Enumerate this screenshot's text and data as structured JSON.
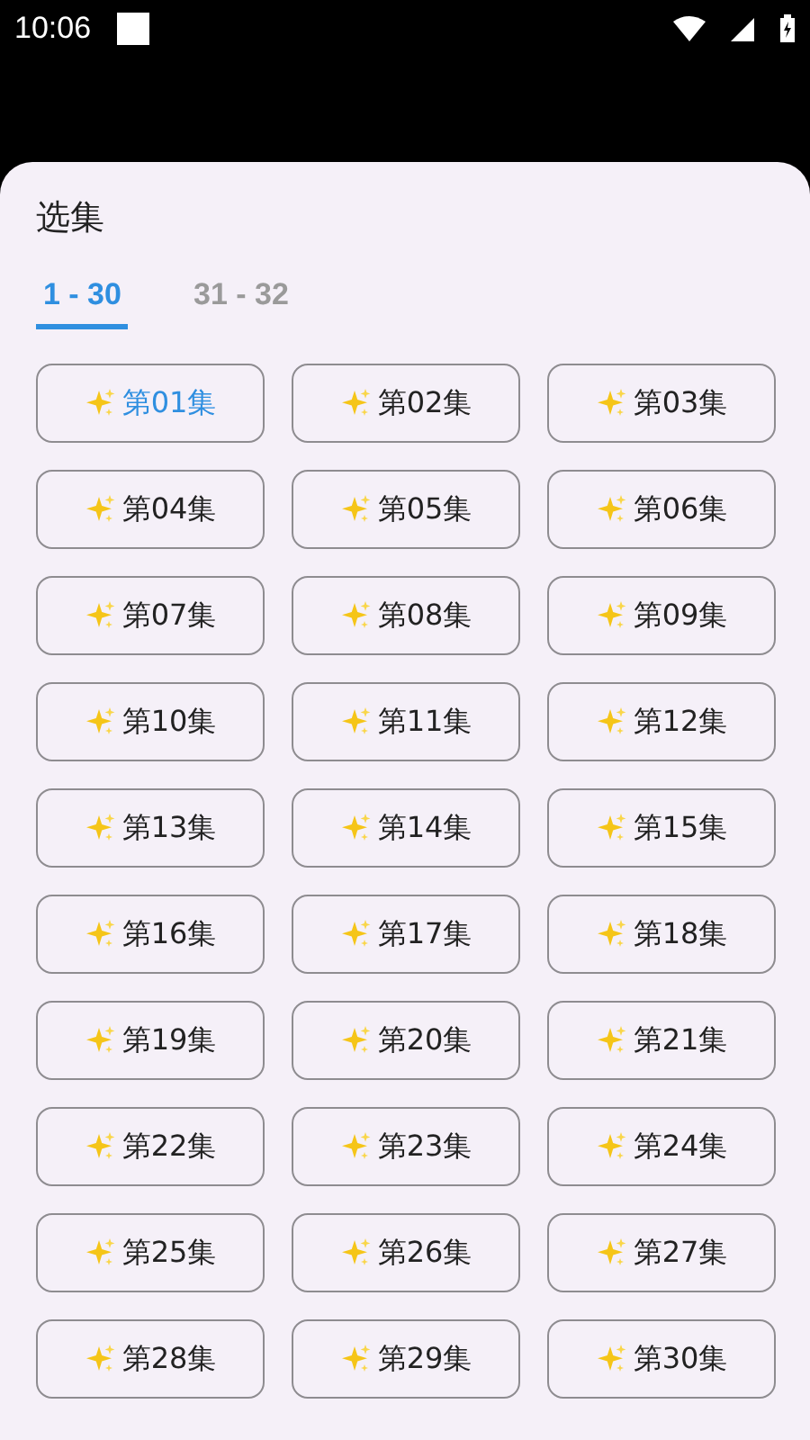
{
  "status_bar": {
    "time": "10:06"
  },
  "sheet": {
    "title": "选集"
  },
  "tabs": [
    {
      "label": "1 - 30",
      "selected": true
    },
    {
      "label": "31 - 32",
      "selected": false
    }
  ],
  "episodes": [
    {
      "label": "第01集",
      "selected": true
    },
    {
      "label": "第02集",
      "selected": false
    },
    {
      "label": "第03集",
      "selected": false
    },
    {
      "label": "第04集",
      "selected": false
    },
    {
      "label": "第05集",
      "selected": false
    },
    {
      "label": "第06集",
      "selected": false
    },
    {
      "label": "第07集",
      "selected": false
    },
    {
      "label": "第08集",
      "selected": false
    },
    {
      "label": "第09集",
      "selected": false
    },
    {
      "label": "第10集",
      "selected": false
    },
    {
      "label": "第11集",
      "selected": false
    },
    {
      "label": "第12集",
      "selected": false
    },
    {
      "label": "第13集",
      "selected": false
    },
    {
      "label": "第14集",
      "selected": false
    },
    {
      "label": "第15集",
      "selected": false
    },
    {
      "label": "第16集",
      "selected": false
    },
    {
      "label": "第17集",
      "selected": false
    },
    {
      "label": "第18集",
      "selected": false
    },
    {
      "label": "第19集",
      "selected": false
    },
    {
      "label": "第20集",
      "selected": false
    },
    {
      "label": "第21集",
      "selected": false
    },
    {
      "label": "第22集",
      "selected": false
    },
    {
      "label": "第23集",
      "selected": false
    },
    {
      "label": "第24集",
      "selected": false
    },
    {
      "label": "第25集",
      "selected": false
    },
    {
      "label": "第26集",
      "selected": false
    },
    {
      "label": "第27集",
      "selected": false
    },
    {
      "label": "第28集",
      "selected": false
    },
    {
      "label": "第29集",
      "selected": false
    },
    {
      "label": "第30集",
      "selected": false
    }
  ]
}
